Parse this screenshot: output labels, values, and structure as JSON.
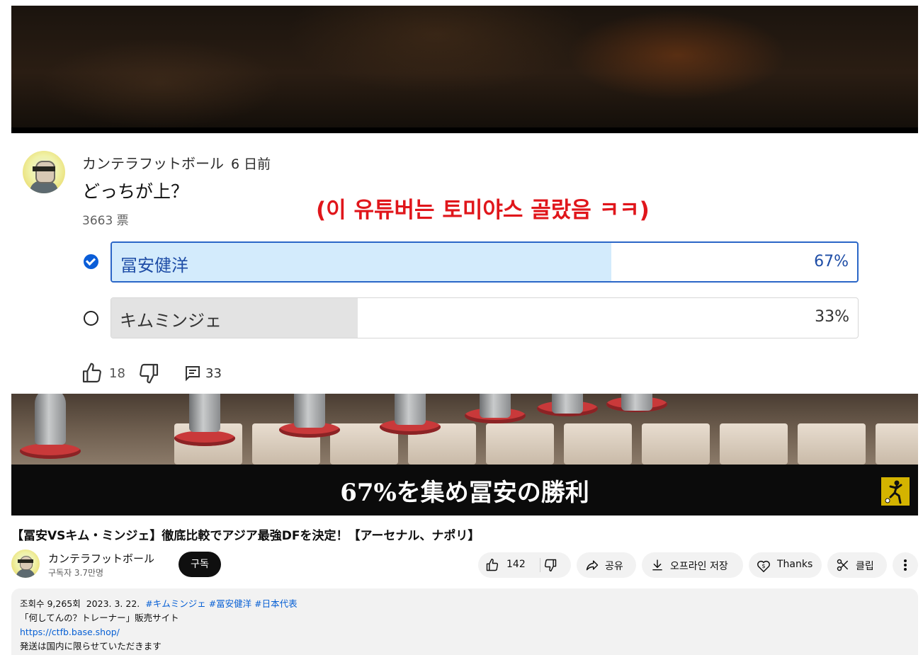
{
  "poll": {
    "author": "カンテラフットボール",
    "time_ago": "6 日前",
    "question": "どっちが上？",
    "votes": "3663 票",
    "options": [
      {
        "label": "冨安健洋",
        "percent": "67%",
        "fraction": 0.67,
        "selected": true
      },
      {
        "label": "キムミンジェ",
        "percent": "33%",
        "fraction": 0.33,
        "selected": false
      }
    ],
    "like_count": "18",
    "comment_count": "33"
  },
  "overlay_caption": "(이 유튜버는 토미야스 골랐음 ㅋㅋ)",
  "video_subtitle": "67%を集め冨安の勝利",
  "video": {
    "title": "【冨安VSキム・ミンジェ】徹底比較でアジア最強DFを決定！【アーセナル、ナポリ】",
    "channel_name": "カンテラフットボール",
    "subscribers": "구독자 3.7만명",
    "subscribe_label": "구독",
    "like_count": "142",
    "share_label": "공유",
    "download_label": "오프라인 저장",
    "thanks_label": "Thanks",
    "clip_label": "클립"
  },
  "description": {
    "views": "조회수 9,265회",
    "date": "2023. 3. 22.",
    "hashtags": [
      "#キムミンジェ",
      "#冨安健洋",
      "#日本代表"
    ],
    "line2": "「何してんの？トレーナー」販売サイト",
    "link": "https://ctfb.base.shop/",
    "line4": "発送は国内に限らせていただきます"
  },
  "colors": {
    "accent_blue": "#065fd4",
    "selected_fill": "#d3ebfc",
    "caption_red": "#e0161b"
  },
  "icons": [
    "check-circle-icon",
    "radio-empty-icon",
    "thumb-up-icon",
    "thumb-down-icon",
    "comment-icon",
    "share-icon",
    "download-icon",
    "thanks-icon",
    "scissors-icon",
    "more-icon"
  ]
}
